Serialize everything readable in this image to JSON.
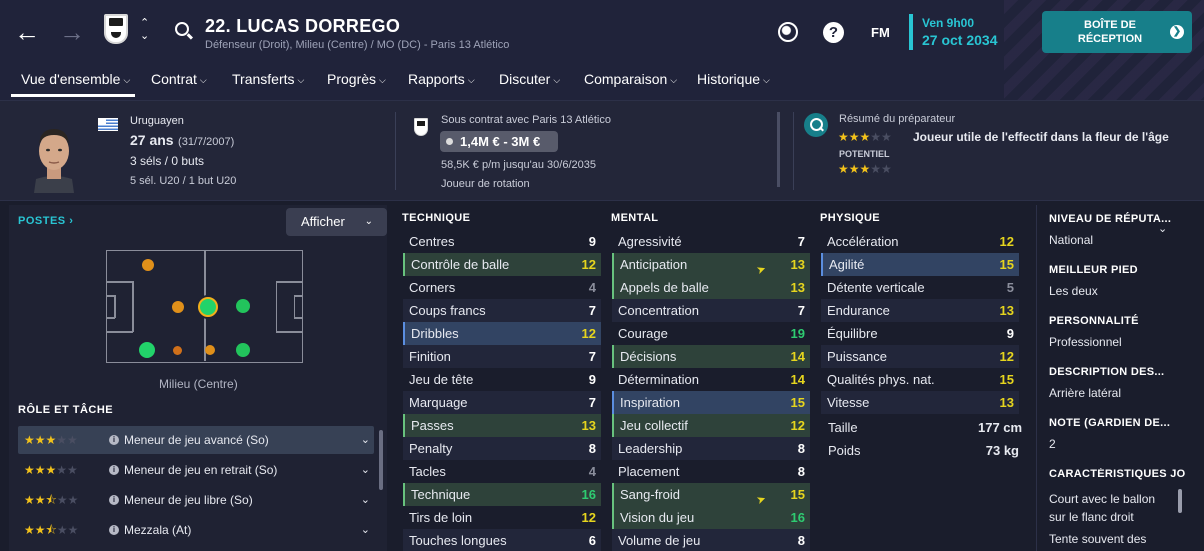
{
  "header": {
    "number_name": "22. LUCAS DORREGO",
    "subtitle": "Défenseur (Droit), Milieu (Centre) / MO (DC) - Paris 13 Atlético",
    "fm_label": "FM",
    "day_time": "Ven 9h00",
    "date": "27 oct 2034",
    "inbox_line1": "BOÎTE DE",
    "inbox_line2": "RÉCEPTION"
  },
  "tabs": [
    "Vue d'ensemble",
    "Contrat",
    "Transferts",
    "Progrès",
    "Rapports",
    "Discuter",
    "Comparaison",
    "Historique"
  ],
  "profile": {
    "nationality": "Uruguayen",
    "age": "27 ans",
    "dob": "(31/7/2007)",
    "caps": "3 séls / 0 buts",
    "u20": "5 sél. U20 / 1 but U20"
  },
  "contract": {
    "label": "Sous contrat avec Paris 13 Atlético",
    "value": "1,4M € - 3M €",
    "wage": "58,5K € p/m jusqu'au 30/6/2035",
    "status": "Joueur de rotation"
  },
  "coach": {
    "label": "Résumé du préparateur",
    "summary": "Joueur utile de l'effectif dans la fleur de l'âge",
    "potential_label": "POTENTIEL",
    "current_stars": 2.5,
    "potential_stars": 2.5
  },
  "positions": {
    "label": "POSTES",
    "afficher": "Afficher",
    "position_name": "Milieu (Centre)"
  },
  "roles": {
    "label": "RÔLE ET TÂCHE",
    "items": [
      {
        "name": "Meneur de jeu avancé (So)",
        "stars": 3
      },
      {
        "name": "Meneur de jeu en retrait (So)",
        "stars": 3
      },
      {
        "name": "Meneur de jeu libre (So)",
        "stars": 2.5
      },
      {
        "name": "Mezzala (At)",
        "stars": 2.5
      }
    ]
  },
  "technique": {
    "label": "TECHNIQUE",
    "items": [
      {
        "name": "Centres",
        "value": "9"
      },
      {
        "name": "Contrôle de balle",
        "value": "12"
      },
      {
        "name": "Corners",
        "value": "4"
      },
      {
        "name": "Coups francs",
        "value": "7"
      },
      {
        "name": "Dribbles",
        "value": "12"
      },
      {
        "name": "Finition",
        "value": "7"
      },
      {
        "name": "Jeu de tête",
        "value": "9"
      },
      {
        "name": "Marquage",
        "value": "7"
      },
      {
        "name": "Passes",
        "value": "13"
      },
      {
        "name": "Penalty",
        "value": "8"
      },
      {
        "name": "Tacles",
        "value": "4"
      },
      {
        "name": "Technique",
        "value": "16"
      },
      {
        "name": "Tirs de loin",
        "value": "12"
      },
      {
        "name": "Touches longues",
        "value": "6"
      }
    ]
  },
  "mental": {
    "label": "MENTAL",
    "items": [
      {
        "name": "Agressivité",
        "value": "7"
      },
      {
        "name": "Anticipation",
        "value": "13"
      },
      {
        "name": "Appels de balle",
        "value": "13"
      },
      {
        "name": "Concentration",
        "value": "7"
      },
      {
        "name": "Courage",
        "value": "19"
      },
      {
        "name": "Décisions",
        "value": "14"
      },
      {
        "name": "Détermination",
        "value": "14"
      },
      {
        "name": "Inspiration",
        "value": "15"
      },
      {
        "name": "Jeu collectif",
        "value": "12"
      },
      {
        "name": "Leadership",
        "value": "8"
      },
      {
        "name": "Placement",
        "value": "8"
      },
      {
        "name": "Sang-froid",
        "value": "15"
      },
      {
        "name": "Vision du jeu",
        "value": "16"
      },
      {
        "name": "Volume de jeu",
        "value": "8"
      }
    ]
  },
  "physique": {
    "label": "PHYSIQUE",
    "items": [
      {
        "name": "Accélération",
        "value": "12"
      },
      {
        "name": "Agilité",
        "value": "15"
      },
      {
        "name": "Détente verticale",
        "value": "5"
      },
      {
        "name": "Endurance",
        "value": "13"
      },
      {
        "name": "Équilibre",
        "value": "9"
      },
      {
        "name": "Puissance",
        "value": "12"
      },
      {
        "name": "Qualités phys. nat.",
        "value": "15"
      },
      {
        "name": "Vitesse",
        "value": "13"
      }
    ],
    "height_label": "Taille",
    "height": "177 cm",
    "weight_label": "Poids",
    "weight": "73 kg"
  },
  "right_panel": [
    {
      "h": "NIVEAU DE RÉPUTA...",
      "v": "National"
    },
    {
      "h": "MEILLEUR PIED",
      "v": "Les deux"
    },
    {
      "h": "PERSONNALITÉ",
      "v": "Professionnel"
    },
    {
      "h": "DESCRIPTION DES...",
      "v": "Arrière latéral"
    },
    {
      "h": "NOTE (GARDIEN DE...",
      "v": "2"
    }
  ],
  "traits": {
    "h": "CARACTÉRISTIQUES JO",
    "l1": "Court avec le ballon",
    "l2": "sur le flanc droit",
    "l3": "Tente souvent des"
  },
  "colors": {
    "accent": "#29c5d3",
    "inbox": "#177f8a",
    "star": "#f2c21b",
    "good": "#2ecc71",
    "mid": "#e6d51e",
    "low": "#ffffff"
  }
}
